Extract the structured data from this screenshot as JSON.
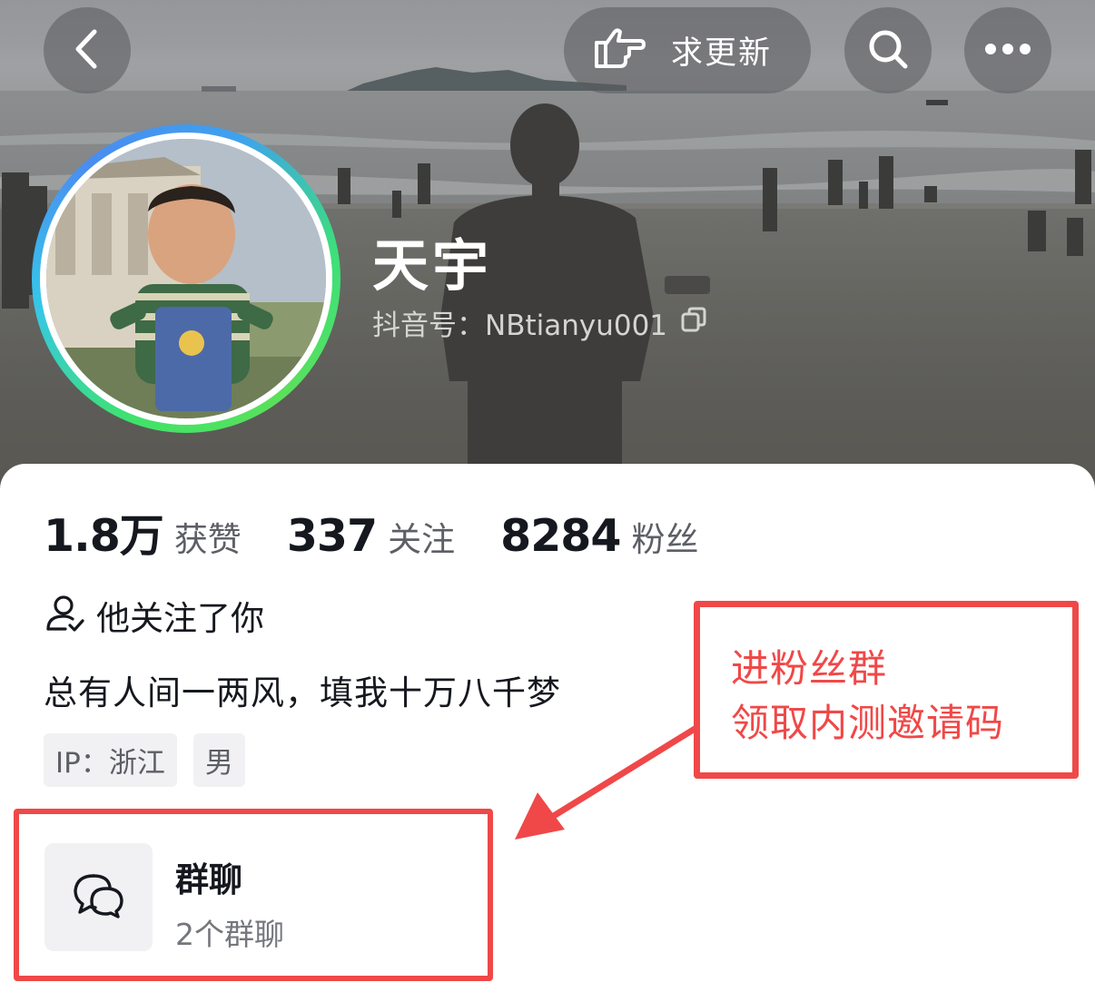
{
  "header": {
    "update_button": {
      "label": "求更新",
      "icon": "pointing-hand-icon"
    },
    "icons": {
      "back": "chevron-left-icon",
      "search": "search-icon",
      "more": "more-icon"
    }
  },
  "profile": {
    "name": "天宇",
    "douyin_id": "抖音号：NBtianyu001",
    "copy_icon": "copy-icon"
  },
  "stats": [
    {
      "value": "1.8万",
      "label": "获赞"
    },
    {
      "value": "337",
      "label": "关注"
    },
    {
      "value": "8284",
      "label": "粉丝"
    }
  ],
  "follow_status": {
    "icon": "user-check-icon",
    "text": "他关注了你"
  },
  "bio": "总有人间一两风，填我十万八千梦",
  "tags": [
    "IP：浙江",
    "男"
  ],
  "group": {
    "icon": "chat-bubbles-icon",
    "title": "群聊",
    "subtitle": "2个群聊"
  },
  "annotation": {
    "lines": [
      "进粉丝群",
      "领取内测邀请码"
    ],
    "color": "#f04848"
  }
}
